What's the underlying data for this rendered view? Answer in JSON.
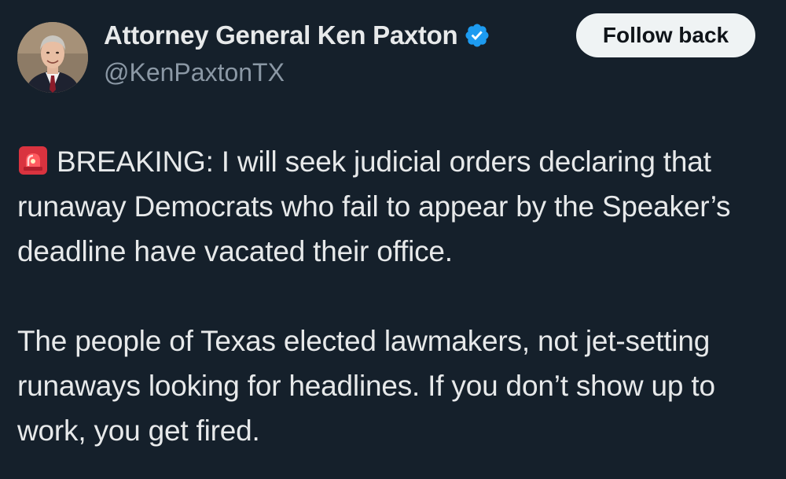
{
  "author": {
    "display_name": "Attorney General Ken Paxton",
    "handle": "@KenPaxtonTX",
    "verified": true,
    "verified_badge_color": "#1d9bf0"
  },
  "actions": {
    "follow_label": "Follow back"
  },
  "tweet": {
    "emoji": "siren-icon",
    "paragraph_1": "BREAKING: I will seek judicial orders declaring that runaway Democrats who fail to appear by the Speaker’s deadline have vacated their office.",
    "paragraph_2": "The people of Texas elected lawmakers, not jet-setting runaways looking for headlines. If you don’t show up to work, you get fired."
  },
  "theme": {
    "background": "#15202b",
    "text": "#e7e9ea",
    "secondary_text": "#8b98a5",
    "button_bg": "#eff3f4"
  }
}
